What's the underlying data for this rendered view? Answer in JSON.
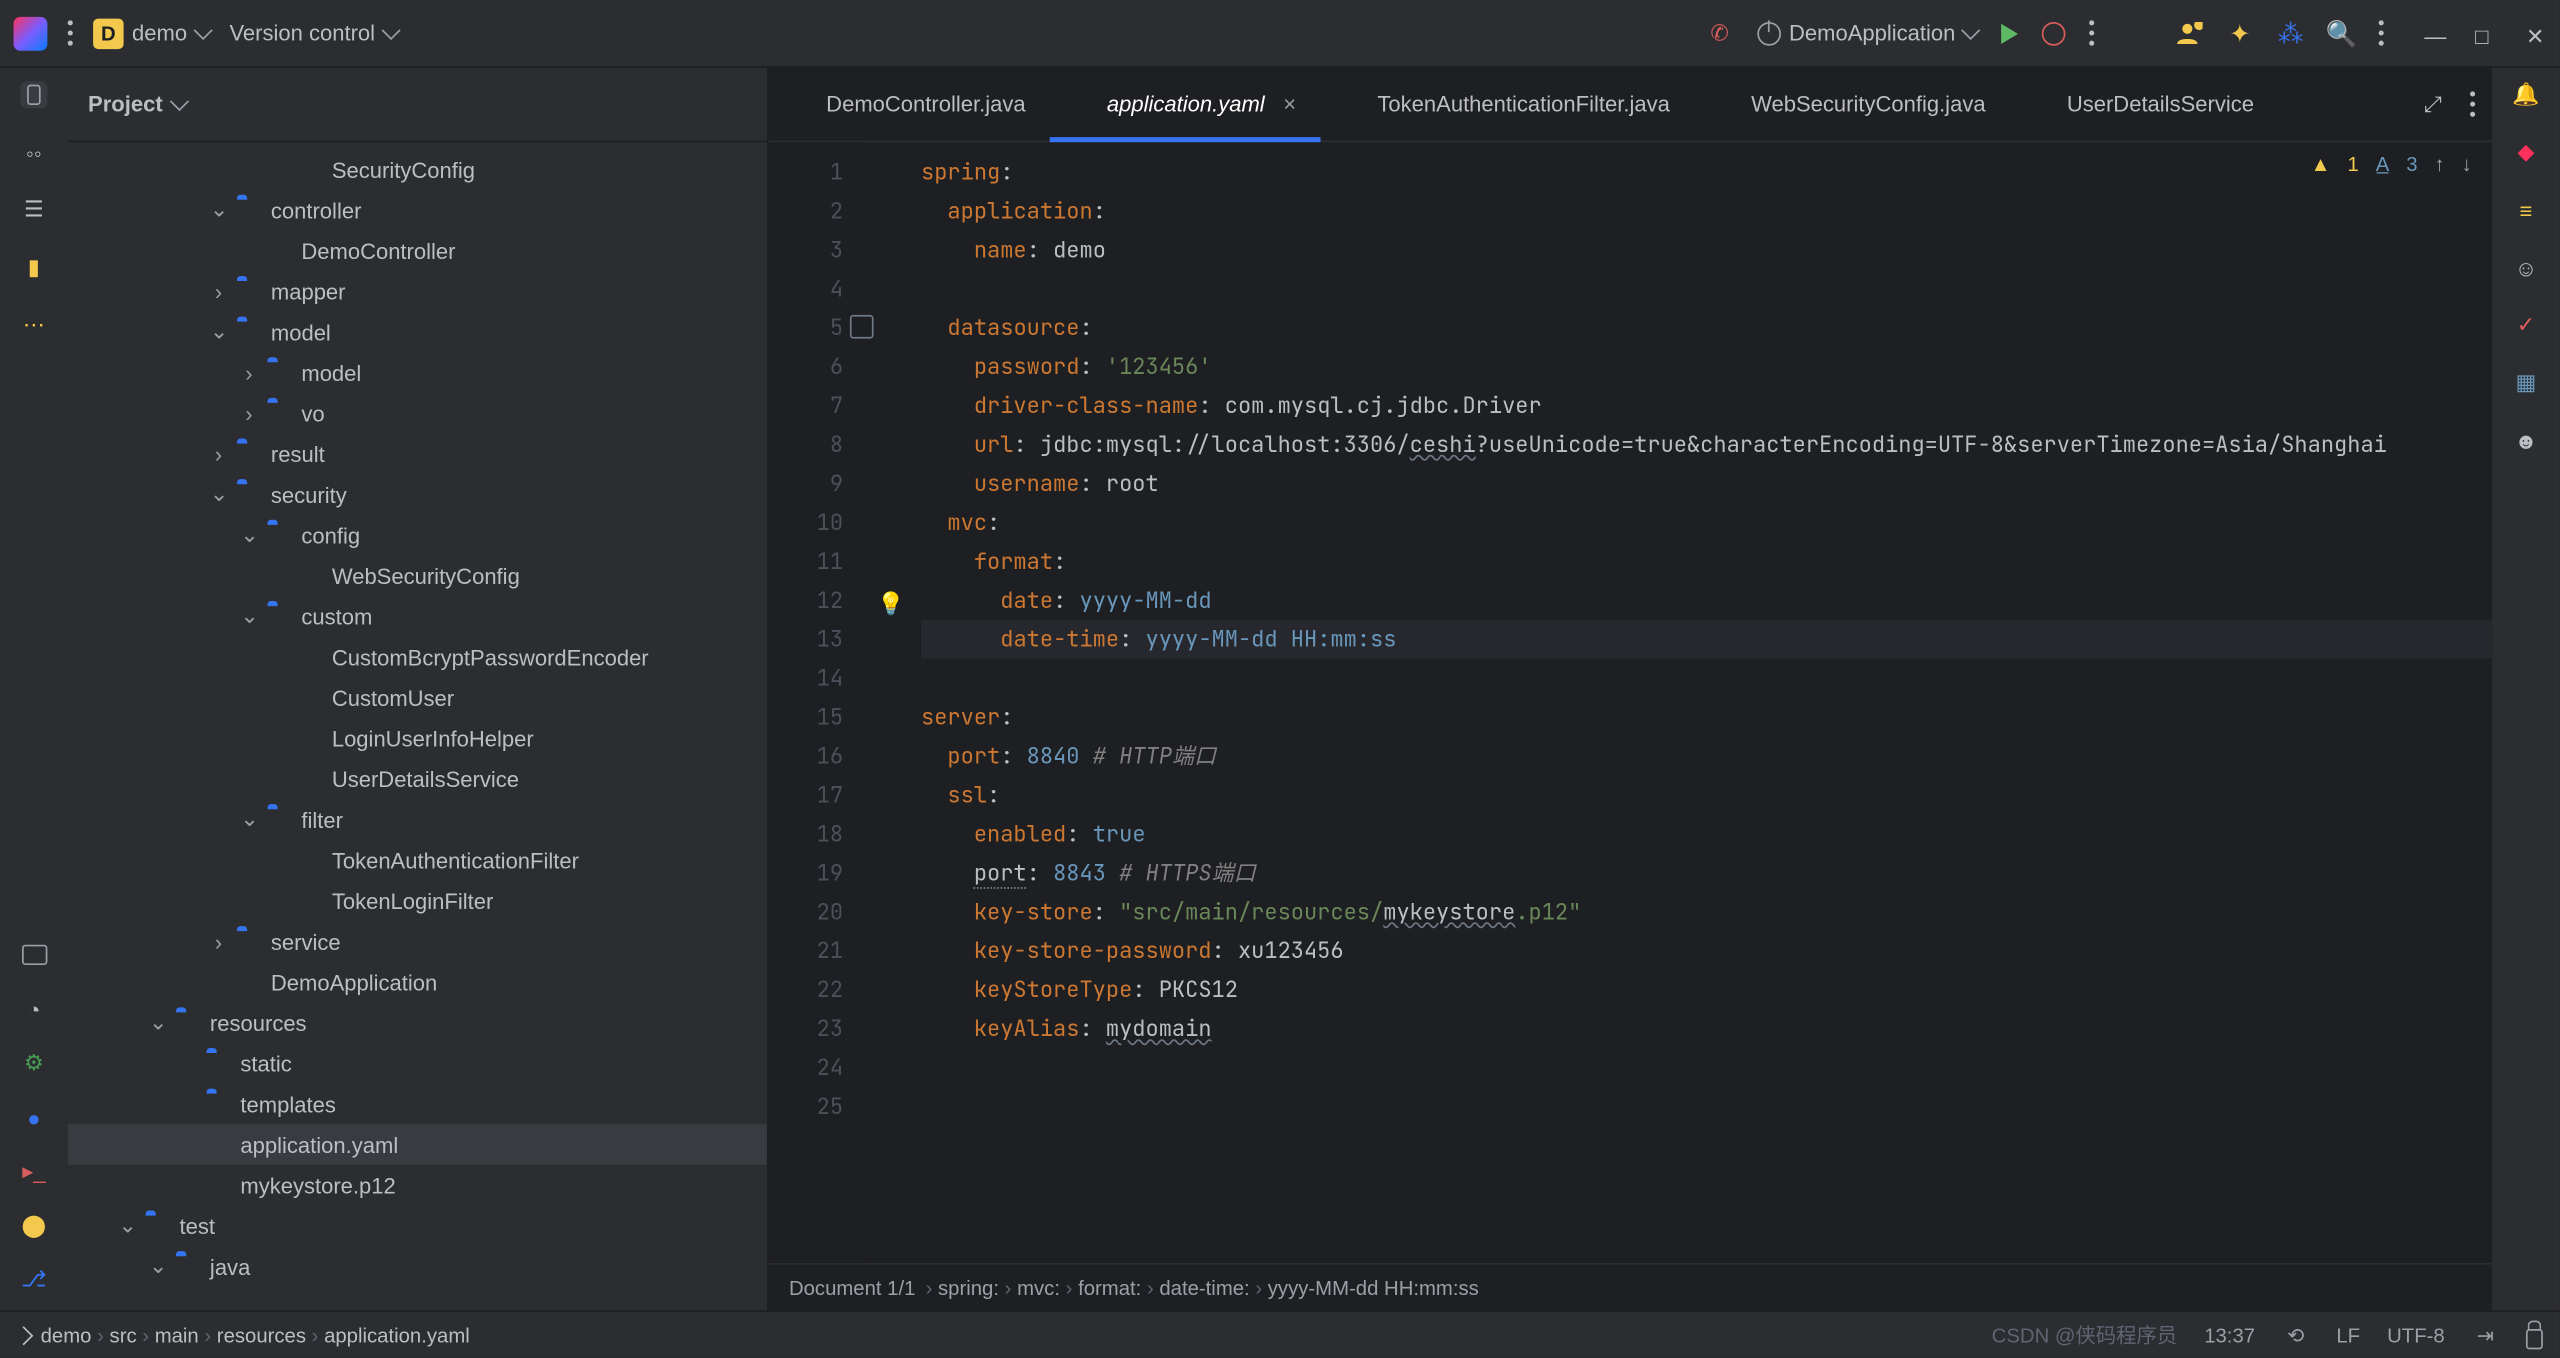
{
  "titlebar": {
    "project_letter": "D",
    "project_name": "demo",
    "vcs_label": "Version control",
    "run_config": "DemoApplication"
  },
  "left_tool": {
    "project_label": "Project"
  },
  "tree": [
    {
      "d": 6,
      "exp": "",
      "ic": "cls",
      "label": "SecurityConfig"
    },
    {
      "d": 4,
      "exp": "v",
      "ic": "fldr-s",
      "label": "controller"
    },
    {
      "d": 5,
      "exp": "",
      "ic": "cls",
      "label": "DemoController"
    },
    {
      "d": 4,
      "exp": ">",
      "ic": "fldr-s",
      "label": "mapper"
    },
    {
      "d": 4,
      "exp": "v",
      "ic": "fldr-s",
      "label": "model"
    },
    {
      "d": 5,
      "exp": ">",
      "ic": "fldr-s",
      "label": "model"
    },
    {
      "d": 5,
      "exp": ">",
      "ic": "fldr-s",
      "label": "vo"
    },
    {
      "d": 4,
      "exp": ">",
      "ic": "fldr-s",
      "label": "result"
    },
    {
      "d": 4,
      "exp": "v",
      "ic": "fldr-s",
      "label": "security"
    },
    {
      "d": 5,
      "exp": "v",
      "ic": "fldr-s",
      "label": "config"
    },
    {
      "d": 6,
      "exp": "",
      "ic": "cls",
      "label": "WebSecurityConfig"
    },
    {
      "d": 5,
      "exp": "v",
      "ic": "fldr-s",
      "label": "custom"
    },
    {
      "d": 6,
      "exp": "",
      "ic": "cls",
      "label": "CustomBcryptPasswordEncoder"
    },
    {
      "d": 6,
      "exp": "",
      "ic": "cls",
      "label": "CustomUser"
    },
    {
      "d": 6,
      "exp": "",
      "ic": "cls",
      "label": "LoginUserInfoHelper"
    },
    {
      "d": 6,
      "exp": "",
      "ic": "cls-i",
      "label": "UserDetailsService"
    },
    {
      "d": 5,
      "exp": "v",
      "ic": "fldr-s",
      "label": "filter"
    },
    {
      "d": 6,
      "exp": "",
      "ic": "cls",
      "label": "TokenAuthenticationFilter"
    },
    {
      "d": 6,
      "exp": "",
      "ic": "cls",
      "label": "TokenLoginFilter"
    },
    {
      "d": 4,
      "exp": ">",
      "ic": "fldr-s",
      "label": "service"
    },
    {
      "d": 4,
      "exp": "",
      "ic": "cls",
      "label": "DemoApplication"
    },
    {
      "d": 2,
      "exp": "v",
      "ic": "fldr-r",
      "label": "resources"
    },
    {
      "d": 3,
      "exp": "",
      "ic": "fldr",
      "label": "static"
    },
    {
      "d": 3,
      "exp": "",
      "ic": "fldr-r",
      "label": "templates"
    },
    {
      "d": 3,
      "exp": "",
      "ic": "yml",
      "label": "application.yaml",
      "sel": true
    },
    {
      "d": 3,
      "exp": "",
      "ic": "file",
      "label": "mykeystore.p12"
    },
    {
      "d": 1,
      "exp": "v",
      "ic": "fldr-t",
      "label": "test"
    },
    {
      "d": 2,
      "exp": "v",
      "ic": "fldr-s",
      "label": "java"
    }
  ],
  "tabs": [
    {
      "label": "DemoController.java",
      "ic": "cls"
    },
    {
      "label": "application.yaml",
      "ic": "yml",
      "active": true,
      "closeable": true
    },
    {
      "label": "TokenAuthenticationFilter.java",
      "ic": "cls"
    },
    {
      "label": "WebSecurityConfig.java",
      "ic": "cls"
    },
    {
      "label": "UserDetailsService",
      "ic": "cls-i"
    }
  ],
  "inspection": {
    "warn_count": "1",
    "typo_count": "3"
  },
  "code_lines": [
    {
      "n": 1,
      "seg": [
        [
          "k",
          "spring"
        ],
        [
          "v",
          ":"
        ]
      ]
    },
    {
      "n": 2,
      "seg": [
        [
          "v",
          "  "
        ],
        [
          "k",
          "application"
        ],
        [
          "v",
          ":"
        ]
      ]
    },
    {
      "n": 3,
      "seg": [
        [
          "v",
          "    "
        ],
        [
          "k",
          "name"
        ],
        [
          "v",
          ": "
        ],
        [
          "v",
          "demo"
        ]
      ]
    },
    {
      "n": 4,
      "seg": []
    },
    {
      "n": 5,
      "seg": [
        [
          "v",
          "  "
        ],
        [
          "k",
          "datasource"
        ],
        [
          "v",
          ":"
        ]
      ]
    },
    {
      "n": 6,
      "seg": [
        [
          "v",
          "    "
        ],
        [
          "k",
          "password"
        ],
        [
          "v",
          ": "
        ],
        [
          "s",
          "'123456'"
        ]
      ]
    },
    {
      "n": 7,
      "seg": [
        [
          "v",
          "    "
        ],
        [
          "k",
          "driver-class-name"
        ],
        [
          "v",
          ": "
        ],
        [
          "v",
          "com.mysql.cj.jdbc.Driver"
        ]
      ]
    },
    {
      "n": 8,
      "seg": [
        [
          "v",
          "    "
        ],
        [
          "k",
          "url"
        ],
        [
          "v",
          ": "
        ],
        [
          "v",
          "jdbc:mysql://localhost:3306/"
        ],
        [
          "ul",
          "ceshi"
        ],
        [
          "v",
          "?useUnicode=true&characterEncoding=UTF-8&serverTimezone=Asia/Shanghai"
        ]
      ]
    },
    {
      "n": 9,
      "seg": [
        [
          "v",
          "    "
        ],
        [
          "k",
          "username"
        ],
        [
          "v",
          ": "
        ],
        [
          "v",
          "root"
        ]
      ]
    },
    {
      "n": 10,
      "seg": [
        [
          "v",
          "  "
        ],
        [
          "k",
          "mvc"
        ],
        [
          "v",
          ":"
        ]
      ]
    },
    {
      "n": 11,
      "seg": [
        [
          "v",
          "    "
        ],
        [
          "k",
          "format"
        ],
        [
          "v",
          ":"
        ]
      ]
    },
    {
      "n": 12,
      "seg": [
        [
          "v",
          "      "
        ],
        [
          "k",
          "date"
        ],
        [
          "v",
          ": "
        ],
        [
          "n",
          "yyyy-MM-dd"
        ]
      ]
    },
    {
      "n": 13,
      "caret": true,
      "seg": [
        [
          "v",
          "      "
        ],
        [
          "k",
          "date-time"
        ],
        [
          "v",
          ": "
        ],
        [
          "n",
          "yyyy-MM-dd HH:mm:ss"
        ]
      ]
    },
    {
      "n": 14,
      "seg": []
    },
    {
      "n": 15,
      "seg": [
        [
          "k",
          "server"
        ],
        [
          "v",
          ":"
        ]
      ]
    },
    {
      "n": 16,
      "seg": [
        [
          "v",
          "  "
        ],
        [
          "k",
          "port"
        ],
        [
          "v",
          ": "
        ],
        [
          "n",
          "8840 "
        ],
        [
          "c",
          "# HTTP端口"
        ]
      ]
    },
    {
      "n": 17,
      "seg": [
        [
          "v",
          "  "
        ],
        [
          "k",
          "ssl"
        ],
        [
          "v",
          ":"
        ]
      ]
    },
    {
      "n": 18,
      "seg": [
        [
          "v",
          "    "
        ],
        [
          "k",
          "enabled"
        ],
        [
          "v",
          ": "
        ],
        [
          "n",
          "true"
        ]
      ]
    },
    {
      "n": 19,
      "seg": [
        [
          "v",
          "    "
        ],
        [
          "ul2",
          "port"
        ],
        [
          "v",
          ": "
        ],
        [
          "n",
          "8843 "
        ],
        [
          "c",
          "# HTTPS端口"
        ]
      ]
    },
    {
      "n": 20,
      "seg": [
        [
          "v",
          "    "
        ],
        [
          "k",
          "key-store"
        ],
        [
          "v",
          ": "
        ],
        [
          "s",
          "\"src/main/resources/"
        ],
        [
          "ul",
          "mykeystore"
        ],
        [
          "s",
          ".p12\""
        ]
      ]
    },
    {
      "n": 21,
      "seg": [
        [
          "v",
          "    "
        ],
        [
          "k",
          "key-store-password"
        ],
        [
          "v",
          ": "
        ],
        [
          "v",
          "xu123456"
        ]
      ]
    },
    {
      "n": 22,
      "seg": [
        [
          "v",
          "    "
        ],
        [
          "k",
          "keyStoreType"
        ],
        [
          "v",
          ": "
        ],
        [
          "v",
          "PKCS12"
        ]
      ]
    },
    {
      "n": 23,
      "seg": [
        [
          "v",
          "    "
        ],
        [
          "k",
          "keyAlias"
        ],
        [
          "v",
          ": "
        ],
        [
          "ul",
          "mydomain"
        ]
      ]
    },
    {
      "n": 24,
      "seg": []
    },
    {
      "n": 25,
      "seg": []
    }
  ],
  "crumbs": {
    "prefix": "Document 1/1",
    "path": [
      "spring:",
      "mvc:",
      "format:",
      "date-time:",
      "yyyy-MM-dd HH:mm:ss"
    ]
  },
  "navbar": {
    "path": [
      "demo",
      "src",
      "main",
      "resources",
      "application.yaml"
    ],
    "status": {
      "time": "13:37",
      "sep": "LF",
      "enc": "UTF-8",
      "spaces": ""
    }
  },
  "watermark": "CSDN @侠码程序员"
}
